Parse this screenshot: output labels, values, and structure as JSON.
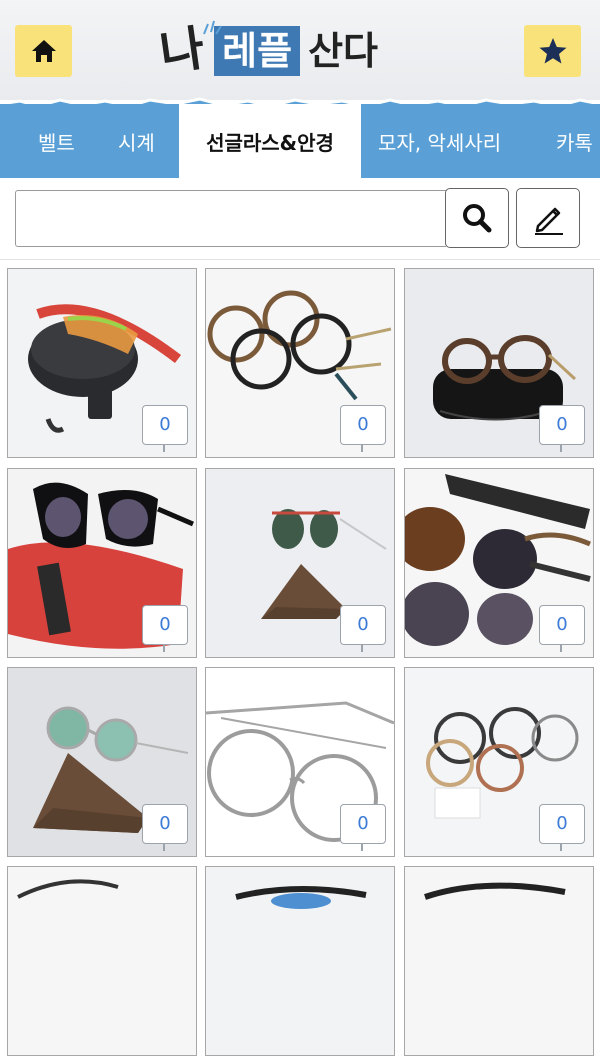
{
  "header": {
    "home_icon": "home-icon",
    "favorite_icon": "star-icon",
    "logo": {
      "prefix": "나",
      "highlight": "레플",
      "suffix": "산다"
    }
  },
  "tabs": [
    {
      "label": "벨트",
      "active": false
    },
    {
      "label": "시계",
      "active": false
    },
    {
      "label": "선글라스&안경",
      "active": true
    },
    {
      "label": "모자, 악세사리",
      "active": false
    },
    {
      "label": "카톡",
      "active": false
    }
  ],
  "search": {
    "value": "",
    "search_icon": "magnifier-icon",
    "write_icon": "pencil-icon"
  },
  "products": [
    {
      "image": "sport-sunglasses-red-with-case",
      "count": "0"
    },
    {
      "image": "round-tortoise-glasses-pair",
      "count": "0"
    },
    {
      "image": "tortoise-glasses-on-black-case",
      "count": "0"
    },
    {
      "image": "cat-eye-sunglasses-on-red-case",
      "count": "0"
    },
    {
      "image": "aviator-sunglasses-on-brown-stand",
      "count": "0"
    },
    {
      "image": "oversized-sunglasses-stack",
      "count": "0"
    },
    {
      "image": "round-mirror-sunglasses-on-stand",
      "count": "0"
    },
    {
      "image": "silver-round-wire-glasses",
      "count": "0"
    },
    {
      "image": "round-frames-assorted",
      "count": "0"
    },
    {
      "image": "partial-glasses-1",
      "count": ""
    },
    {
      "image": "partial-glasses-2",
      "count": ""
    },
    {
      "image": "partial-glasses-3",
      "count": ""
    }
  ],
  "colors": {
    "tab_bar": "#5aa0d6",
    "header_button": "#f9e27a",
    "logo_blue": "#3f79b3",
    "count_text": "#3d7bd6"
  }
}
